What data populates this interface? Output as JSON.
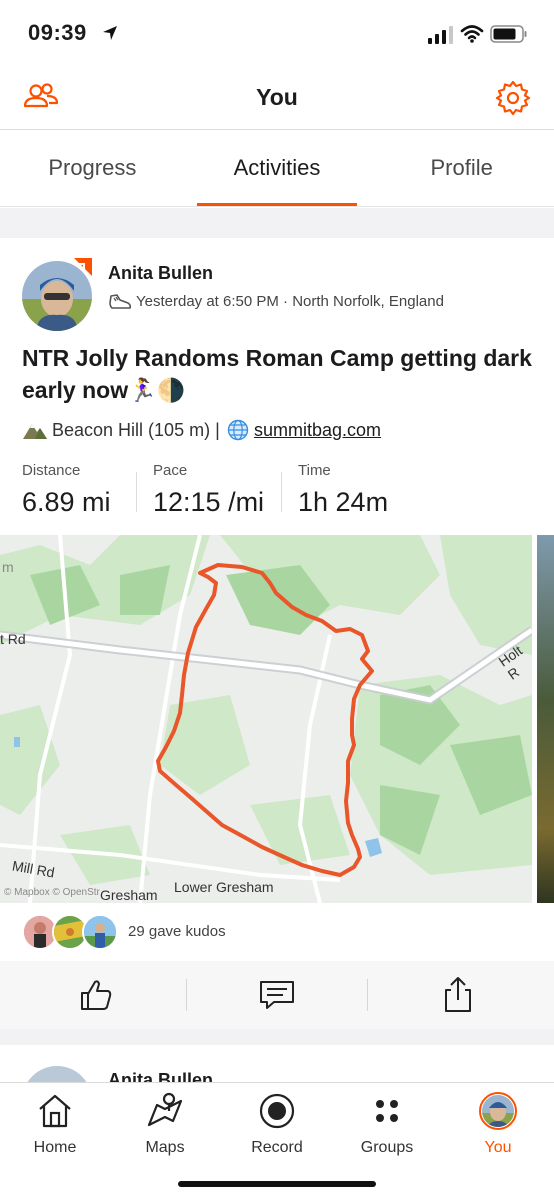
{
  "status_bar": {
    "time": "09:39"
  },
  "header": {
    "title": "You"
  },
  "tabs": [
    {
      "label": "Progress",
      "active": false
    },
    {
      "label": "Activities",
      "active": true
    },
    {
      "label": "Profile",
      "active": false
    }
  ],
  "activity": {
    "athlete_name": "Anita Bullen",
    "meta": "Yesterday at 6:50 PM · North Norfolk, England",
    "title": "NTR Jolly Randoms Roman Camp getting dark early now🏃‍♀️🌗",
    "summit": "Beacon Hill (105 m) |",
    "link": "summitbag.com",
    "stats": [
      {
        "label": "Distance",
        "value": "6.89 mi"
      },
      {
        "label": "Pace",
        "value": "12:15 /mi"
      },
      {
        "label": "Time",
        "value": "1h 24m"
      }
    ],
    "map_labels": {
      "rd_left": "t Rd",
      "holt": "Holt R",
      "mill_rd": "Mill Rd",
      "gresham": "Gresham",
      "lower_gresham": "Lower Gresham",
      "attribution": "© Mapbox © OpenStr",
      "m": "m"
    },
    "kudos": "29 gave kudos"
  },
  "next_activity": {
    "athlete_name": "Anita Bullen"
  },
  "tab_bar": [
    {
      "label": "Home",
      "icon": "home-icon"
    },
    {
      "label": "Maps",
      "icon": "map-icon"
    },
    {
      "label": "Record",
      "icon": "record-icon"
    },
    {
      "label": "Groups",
      "icon": "groups-icon"
    },
    {
      "label": "You",
      "icon": "avatar",
      "active": true
    }
  ],
  "colors": {
    "accent": "#fc5200",
    "route": "#e8562a"
  }
}
